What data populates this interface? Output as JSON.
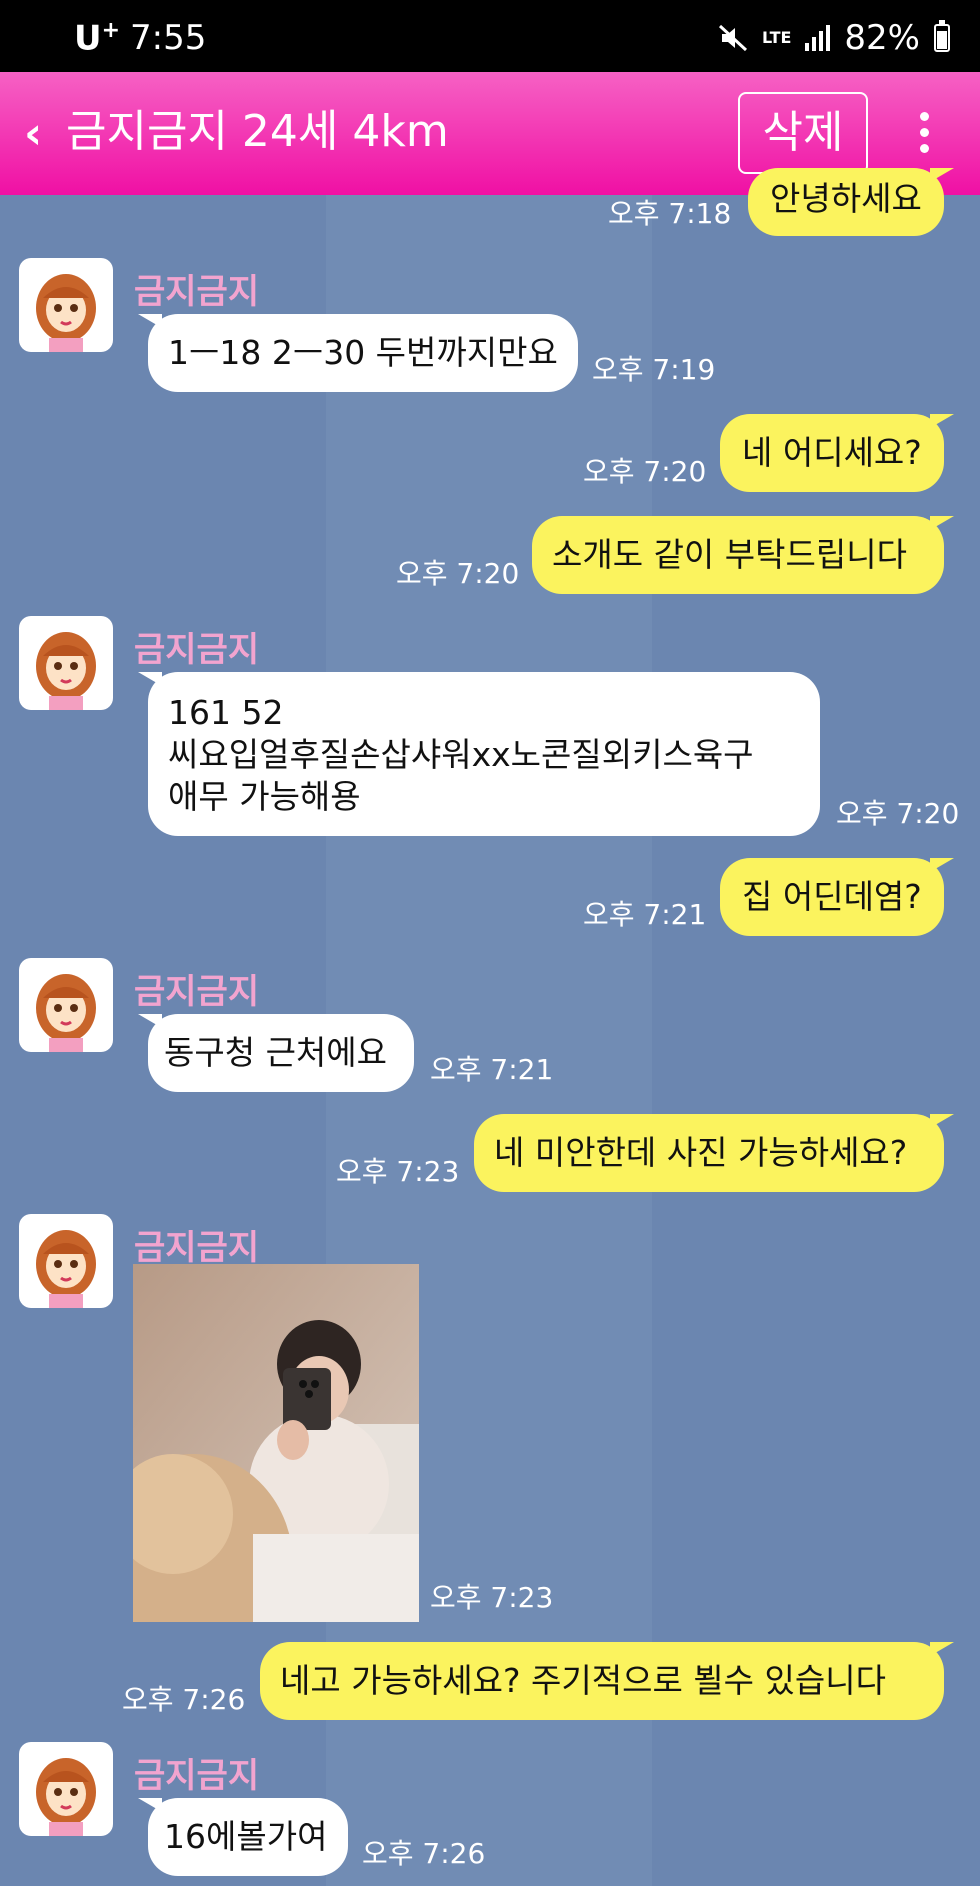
{
  "status_bar": {
    "carrier": "U",
    "carrier_sup": "+",
    "time": "7:55",
    "network": "LTE",
    "battery": "82%",
    "battery_level": 0.82
  },
  "header": {
    "title": "금지금지 24세 4km",
    "delete_label": "삭제"
  },
  "messages": [
    {
      "dir": "out",
      "text": "안녕하세요",
      "time": "오후 7:18"
    },
    {
      "dir": "in",
      "sender": "금지금지",
      "text": "1ㅡ18 2ㅡ30 두번까지만요",
      "time": "오후 7:19"
    },
    {
      "dir": "out",
      "text": "네 어디세요?",
      "time": "오후 7:20"
    },
    {
      "dir": "out",
      "text": "소개도 같이 부탁드립니다",
      "time": "오후 7:20"
    },
    {
      "dir": "in",
      "sender": "금지금지",
      "lines": [
        "161 52",
        "씨요입얼후질손삽샤워xx노콘질외키스육구",
        "애무 가능해용"
      ],
      "time": "오후 7:20"
    },
    {
      "dir": "out",
      "text": "집 어딘데염?",
      "time": "오후 7:21"
    },
    {
      "dir": "in",
      "sender": "금지금지",
      "text": "동구청 근처에요",
      "time": "오후 7:21"
    },
    {
      "dir": "out",
      "text": "네 미안한데 사진 가능하세요?",
      "time": "오후 7:23"
    },
    {
      "dir": "in",
      "sender": "금지금지",
      "image": true,
      "time": "오후 7:23"
    },
    {
      "dir": "out",
      "text": "네고 가능하세요?  주기적으로 뵐수 있습니다",
      "time": "오후 7:26"
    },
    {
      "dir": "in",
      "sender": "금지금지",
      "text": "16에볼가여",
      "time": "오후 7:26"
    }
  ]
}
